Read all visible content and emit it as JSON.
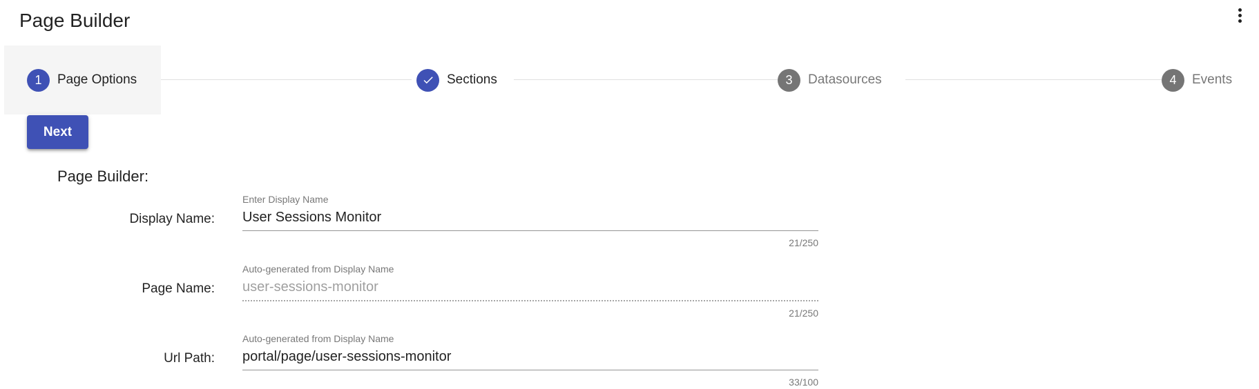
{
  "header": {
    "title": "Page Builder",
    "menu_icon": "more-vert-icon"
  },
  "stepper": {
    "steps": [
      {
        "number": "1",
        "label": "Page Options",
        "state": "active",
        "circle_color": "#3f51b5"
      },
      {
        "number": "",
        "label": "Sections",
        "state": "done",
        "icon": "check-icon",
        "circle_color": "#3f51b5"
      },
      {
        "number": "3",
        "label": "Datasources",
        "state": "pending",
        "circle_color": "#757575"
      },
      {
        "number": "4",
        "label": "Events",
        "state": "pending",
        "circle_color": "#757575"
      }
    ]
  },
  "actions": {
    "next_label": "Next"
  },
  "form": {
    "title": "Page Builder:",
    "fields": [
      {
        "label": "Display Name:",
        "float_label": "Enter Display Name",
        "value": "User Sessions Monitor",
        "counter": "21/250",
        "disabled": false
      },
      {
        "label": "Page Name:",
        "float_label": "Auto-generated from Display Name",
        "value": "user-sessions-monitor",
        "counter": "21/250",
        "disabled": true
      },
      {
        "label": "Url Path:",
        "float_label": "Auto-generated from Display Name",
        "value": "portal/page/user-sessions-monitor",
        "counter": "33/100",
        "disabled": false
      }
    ]
  },
  "colors": {
    "primary": "#3f51b5",
    "step_pending": "#757575",
    "active_step_bg": "#f5f5f5"
  }
}
